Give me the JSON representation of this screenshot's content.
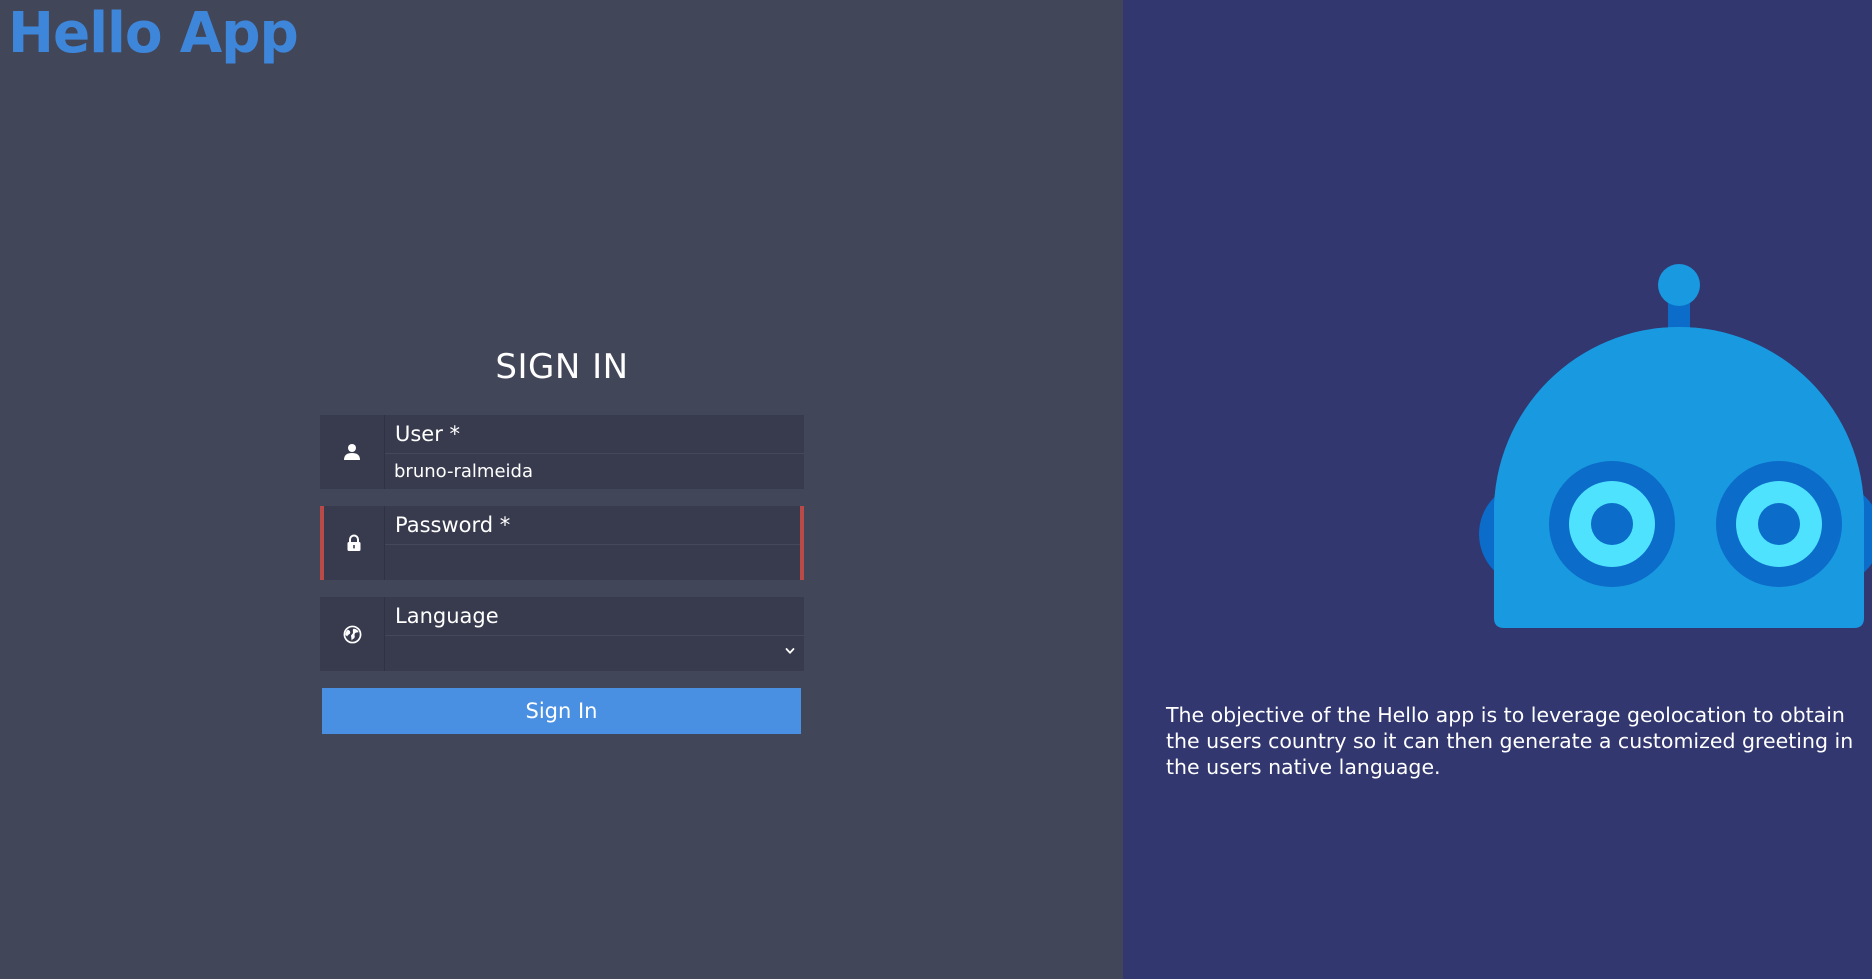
{
  "app": {
    "logo_text": "Hello App"
  },
  "login": {
    "title": "SIGN IN",
    "user": {
      "label": "User *",
      "value": "bruno-ralmeida",
      "icon": "user-icon"
    },
    "password": {
      "label": "Password *",
      "value": "",
      "icon": "lock-icon",
      "state": "error"
    },
    "language": {
      "label": "Language",
      "selected": "",
      "icon": "globe-icon"
    },
    "submit_label": "Sign In"
  },
  "info": {
    "description": "The objective of the Hello app is to leverage geolocation to obtain the users country so it can then generate a customized greeting in the users native language.",
    "illustration": "robot-illustration"
  },
  "colors": {
    "left_background": "#424659",
    "right_background": "#323770",
    "field_background": "#383b4e",
    "accent": "#4a90e2",
    "logo": "#3e86da",
    "error": "#b94a48",
    "robot_primary": "#1899e0",
    "robot_dark": "#0b6cc9",
    "robot_eye": "#4ee2ff"
  }
}
